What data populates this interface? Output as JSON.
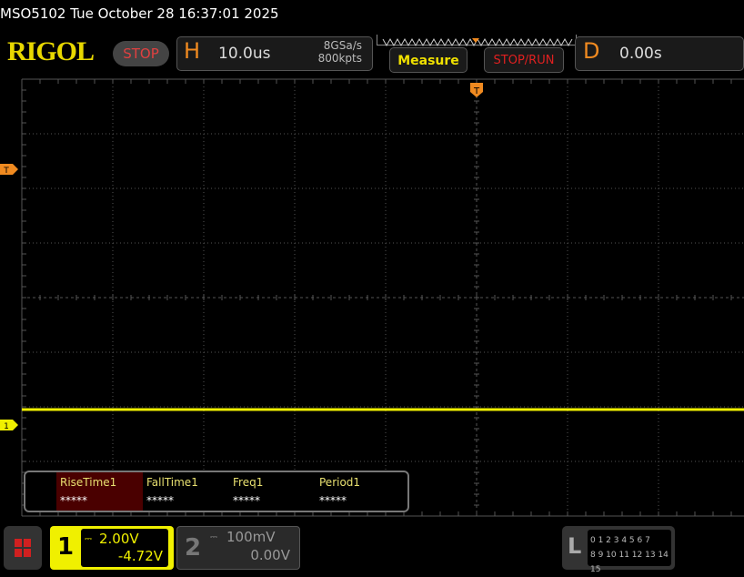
{
  "header": {
    "title": "MSO5102  Tue October 28 16:37:01 2025",
    "logo": "RIGOL",
    "run_state": "STOP"
  },
  "horizontal": {
    "label": "H",
    "timebase": "10.0us",
    "sample_rate": "8GSa/s",
    "memory_depth": "800kpts"
  },
  "buttons": {
    "measure": "Measure",
    "stop_run": "STOP/RUN"
  },
  "delay": {
    "label": "D",
    "value": "0.00s"
  },
  "markers": {
    "trigger": "T",
    "trigger_level": "T",
    "channel1": "1"
  },
  "measurements": [
    {
      "label": "RiseTime1",
      "value": "*****",
      "selected": true
    },
    {
      "label": "FallTime1",
      "value": "*****"
    },
    {
      "label": "Freq1",
      "value": "*****"
    },
    {
      "label": "Period1",
      "value": "*****"
    }
  ],
  "channels": [
    {
      "number": "1",
      "scale": "2.00V",
      "offset": "-4.72V",
      "coupling": "dc-icon",
      "color": "#f0f000",
      "active": true
    },
    {
      "number": "2",
      "scale": "100mV",
      "offset": "0.00V",
      "coupling": "dc-icon",
      "color": "#888888",
      "active": false
    }
  ],
  "logic": {
    "label": "L",
    "row1": "0 1 2 3  4 5 6 7",
    "row2": "8 9 10 11 12 13 14 15"
  },
  "colors": {
    "trace": "#f0f000",
    "accent": "#f08a20",
    "stop": "#e04040"
  }
}
